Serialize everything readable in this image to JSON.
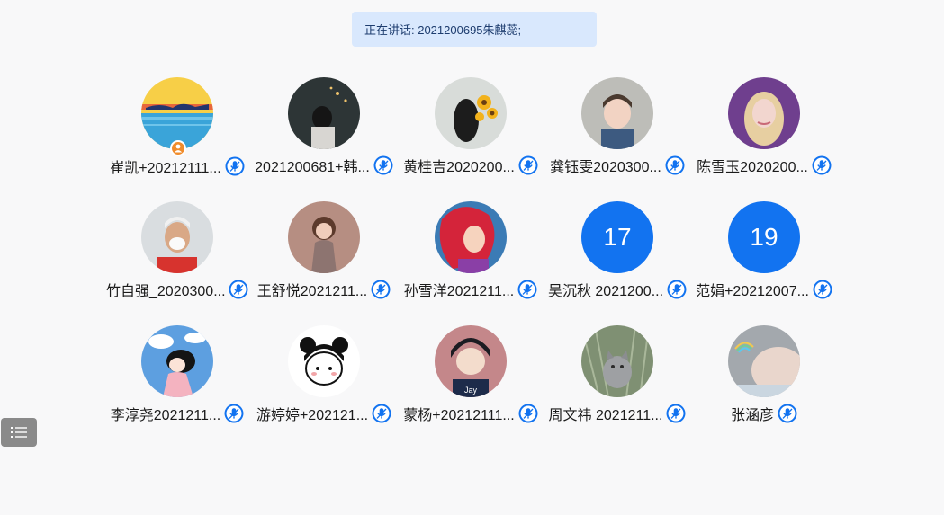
{
  "speaking": {
    "text": "正在讲话: 2021200695朱麒蕊;"
  },
  "participants": [
    {
      "name": "崔凯+20212111...",
      "avatar": "sunset-illustration-avatar",
      "host": true
    },
    {
      "name": "2021200681+韩...",
      "avatar": "girl-photo-avatar"
    },
    {
      "name": "黄桂吉2020200...",
      "avatar": "sunflower-photo-avatar"
    },
    {
      "name": "龚钰雯2020300...",
      "avatar": "child-photo-avatar"
    },
    {
      "name": "陈雪玉2020200...",
      "avatar": "woman-purple-photo-avatar"
    },
    {
      "name": "竹自强_2020300...",
      "avatar": "masked-man-photo-avatar"
    },
    {
      "name": "王舒悦2021211...",
      "avatar": "little-girl-photo-avatar"
    },
    {
      "name": "孙雪洋2021211...",
      "avatar": "mermaid-cartoon-avatar"
    },
    {
      "name": "吴沉秋 2021200...",
      "avatar_number": "17"
    },
    {
      "name": "范娟+20212007...",
      "avatar_number": "19"
    },
    {
      "name": "李淳尧2021211...",
      "avatar": "cartoon-girl-sky-avatar"
    },
    {
      "name": "游婷婷+202121...",
      "avatar": "cartoon-bun-girl-avatar"
    },
    {
      "name": "蒙杨+20212111...",
      "avatar": "cartoon-jay-boy-avatar"
    },
    {
      "name": "周文祎 2021211...",
      "avatar": "cat-photo-avatar"
    },
    {
      "name": "张涵彦",
      "avatar": "rainbow-sky-avatar"
    }
  ],
  "colors": {
    "banner_bg": "#d9e8fd",
    "number_avatar_bg": "#1273f0",
    "mic_blue": "#1273f0",
    "host_badge": "#f08c2c"
  },
  "icons": {
    "mic": "mic-icon",
    "host": "host-icon",
    "menu": "list-menu-icon"
  }
}
